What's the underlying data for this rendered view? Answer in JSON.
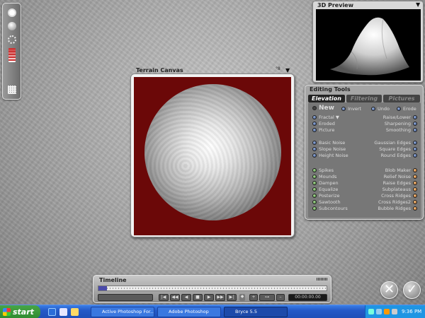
{
  "palette": {
    "icons": [
      "circle-icon",
      "sphere-icon",
      "dotted-circle-icon",
      "gradient-icon",
      "grid-icon"
    ]
  },
  "canvas": {
    "title": "Terrain Canvas",
    "menu_glyph": "▼",
    "extra_glyph": "°8"
  },
  "preview": {
    "title": "3D Preview",
    "menu_glyph": "▼"
  },
  "tools": {
    "title": "Editing Tools",
    "tabs": [
      "Elevation",
      "Filtering",
      "Pictures"
    ],
    "top": {
      "new": "New",
      "invert": "Invert",
      "undo": "Undo",
      "erode": "Erode"
    },
    "left_col": [
      {
        "label": "Fractal ▼"
      },
      {
        "label": "Eroded"
      },
      {
        "label": "Picture"
      },
      {
        "label": "Basic Noise"
      },
      {
        "label": "Slope Noise"
      },
      {
        "label": "Height Noise"
      },
      {
        "label": "Spikes"
      },
      {
        "label": "Mounds"
      },
      {
        "label": "Dampen"
      },
      {
        "label": "Equalize"
      },
      {
        "label": "Posterize"
      },
      {
        "label": "Sawtooth"
      },
      {
        "label": "Subcontours"
      }
    ],
    "right_col": [
      {
        "label": "Raise/Lower"
      },
      {
        "label": "Sharpening"
      },
      {
        "label": "Smoothing"
      },
      {
        "label": "Gaussian Edges"
      },
      {
        "label": "Square Edges"
      },
      {
        "label": "Round Edges"
      },
      {
        "label": "Blob Maker"
      },
      {
        "label": "Relief Noise"
      },
      {
        "label": "Raise Edges"
      },
      {
        "label": "Subplateaus"
      },
      {
        "label": "Cross Ridges"
      },
      {
        "label": "Cross Ridges2"
      },
      {
        "label": "Bubble Ridges"
      }
    ]
  },
  "timeline": {
    "title": "Timeline",
    "time": "00:00:00.00",
    "transport": [
      "|◀",
      "◀◀",
      "◀",
      "■",
      "▶",
      "▶▶",
      "▶|"
    ],
    "plus": "+",
    "key_glyph": "⊶",
    "minus": "–",
    "marker": "◆"
  },
  "confirm": {
    "cancel": "✕",
    "ok": "✓"
  },
  "taskbar": {
    "start": "start",
    "tasks": [
      {
        "label": "Active Photoshop For...",
        "active": false
      },
      {
        "label": "Adobe Photoshop",
        "active": false
      },
      {
        "label": "Bryce 5.5",
        "active": true
      }
    ],
    "clock": "9:36 PM"
  },
  "colors": {
    "canvas_bg": "#6b0808",
    "taskbar": "#2459c8",
    "start": "#2f8a2f"
  }
}
